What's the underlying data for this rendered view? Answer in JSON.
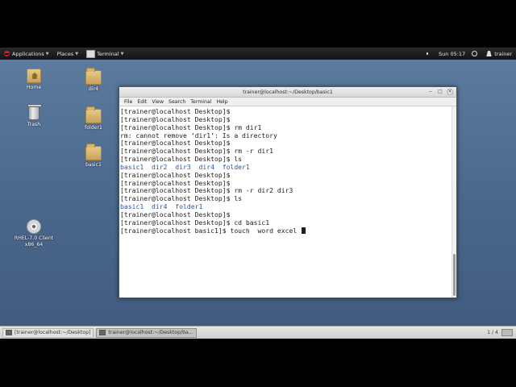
{
  "top_panel": {
    "applications": "Applications",
    "places": "Places",
    "terminal": "Terminal",
    "clock": "Sun 05:17",
    "user": "trainer"
  },
  "desktop_icons": [
    {
      "label": "Home",
      "icon": "home-folder-icon"
    },
    {
      "label": "Trash",
      "icon": "trash-icon"
    },
    {
      "label": "dir4",
      "icon": "folder-icon"
    },
    {
      "label": "folder1",
      "icon": "folder-icon"
    },
    {
      "label": "basic1",
      "icon": "folder-icon"
    },
    {
      "label": "RHEL-7.0 Client x86_64",
      "icon": "disc-icon"
    }
  ],
  "terminal": {
    "title": "trainer@localhost:~/Desktop/basic1",
    "menu": [
      "File",
      "Edit",
      "View",
      "Search",
      "Terminal",
      "Help"
    ],
    "lines": [
      "[trainer@localhost Desktop]$",
      "[trainer@localhost Desktop]$",
      "[trainer@localhost Desktop]$ rm dir1",
      "rm: cannot remove ‘dir1’: Is a directory",
      "[trainer@localhost Desktop]$",
      "[trainer@localhost Desktop]$ rm -r dir1",
      "[trainer@localhost Desktop]$ ls",
      "basic1  dir2  dir3  dir4  folder1",
      "[trainer@localhost Desktop]$",
      "[trainer@localhost Desktop]$",
      "[trainer@localhost Desktop]$ rm -r dir2 dir3",
      "[trainer@localhost Desktop]$ ls",
      "basic1  dir4  folder1",
      "[trainer@localhost Desktop]$",
      "[trainer@localhost Desktop]$ cd basic1",
      "[trainer@localhost basic1]$ touch  word excel "
    ]
  },
  "taskbar": {
    "tasks": [
      "[trainer@localhost:~/Desktop]",
      "trainer@localhost:~/Desktop/ba..."
    ],
    "workspace": "1 / 4"
  }
}
